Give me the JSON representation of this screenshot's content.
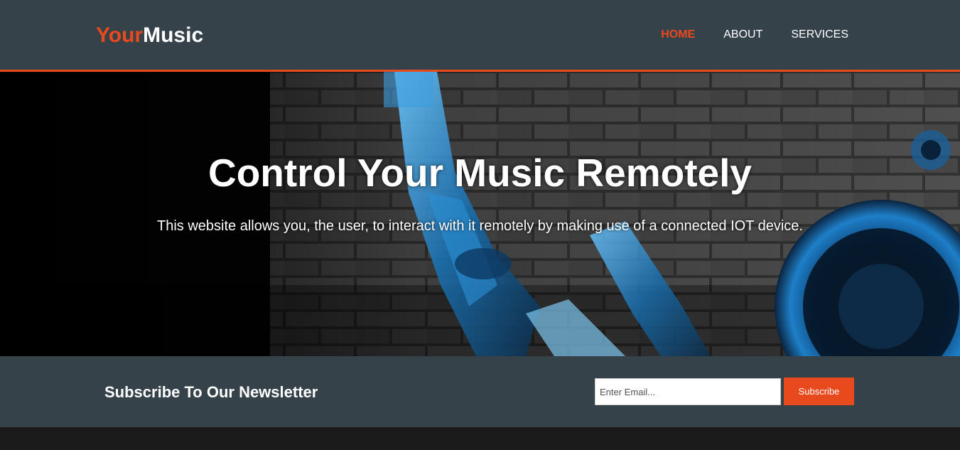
{
  "header": {
    "logo_accent": "Your",
    "logo_rest": "Music",
    "nav": [
      {
        "label": "HOME",
        "active": true
      },
      {
        "label": "ABOUT",
        "active": false
      },
      {
        "label": "SERVICES",
        "active": false
      }
    ]
  },
  "hero": {
    "title": "Control Your Music Remotely",
    "subtitle": "This website allows you, the user, to interact with it remotely by making use of a connected IOT device."
  },
  "newsletter": {
    "heading": "Subscribe To Our Newsletter",
    "email_placeholder": "Enter Email...",
    "subscribe_label": "Subscribe"
  },
  "colors": {
    "accent": "#e8491d",
    "header_bg": "#35424a",
    "footer_bg": "#1b1b1b"
  }
}
